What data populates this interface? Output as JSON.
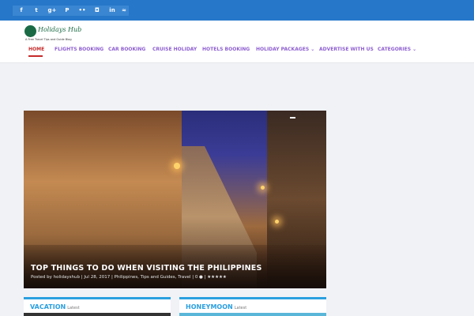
{
  "social": [
    {
      "icon": "facebook-icon",
      "glyph": "f"
    },
    {
      "icon": "twitter-icon",
      "glyph": "t"
    },
    {
      "icon": "google-plus-icon",
      "glyph": "g+"
    },
    {
      "icon": "pinterest-icon",
      "glyph": "P"
    },
    {
      "icon": "flickr-icon",
      "glyph": "••"
    },
    {
      "icon": "instagram-icon",
      "glyph": "◘"
    },
    {
      "icon": "linkedin-icon",
      "glyph": "in"
    },
    {
      "icon": "rss-icon",
      "glyph": "≈"
    }
  ],
  "logo": {
    "name": "Holidays Hub",
    "tagline": "A Free Travel Tips and Guide Blog"
  },
  "nav": [
    "HOME",
    "FLIGHTS BOOKING",
    "CAR BOOKING",
    "CRUISE HOLIDAY",
    "HOTELS BOOKING",
    "HOLIDAY PACKAGES ⌄",
    "ADVERTISE WITH US",
    "CATEGORIES ⌄"
  ],
  "slider": {
    "title": "TOP THINGS TO DO WHEN VISITING THE PHILIPPINES",
    "meta": "Posted by holidayshub | Jul 28, 2017 | Philippines, Tips and Guides, Travel | 0 ● | ★★★★★"
  },
  "cards": [
    {
      "title": "VACATION",
      "sub": "Latest"
    },
    {
      "title": "HONEYMOON",
      "sub": "Latest"
    }
  ],
  "colors": {
    "topbar": "#2677c9",
    "accent": "#2b9fe0",
    "nav": "#8e5fd0",
    "active": "#c62a2a"
  }
}
